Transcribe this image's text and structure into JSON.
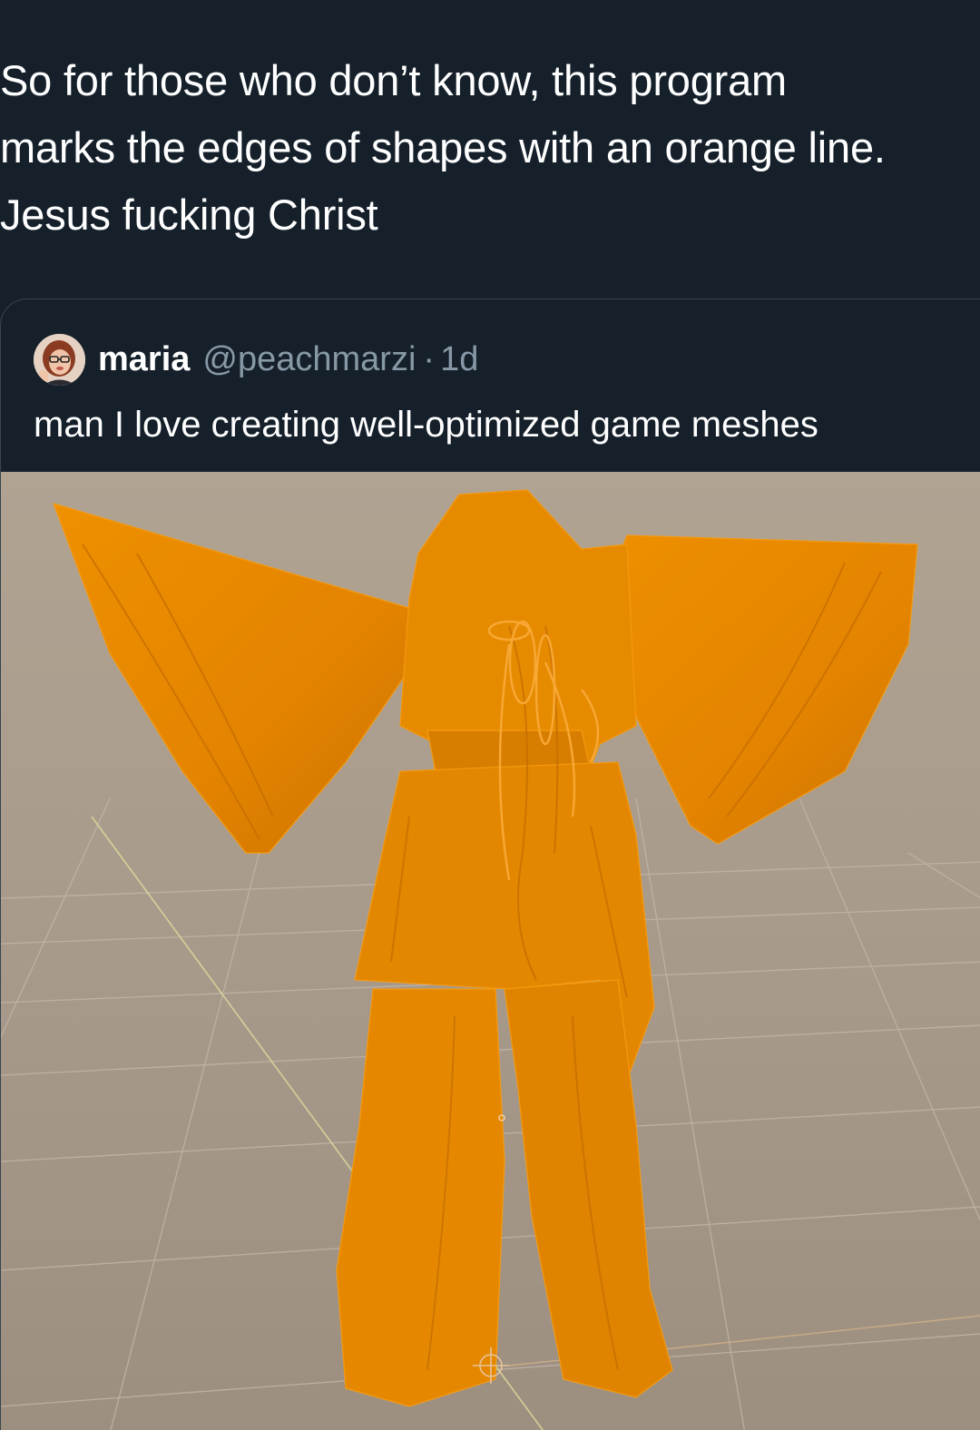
{
  "tweet": {
    "line1": "So for those who don’t know, this program",
    "line2": "marks the edges of shapes with an orange line.",
    "line3": "Jesus fucking Christ"
  },
  "quoted_tweet": {
    "display_name": "maria",
    "handle": "@peachmarzi",
    "separator": "·",
    "age": "1d",
    "text": "man I love creating well-optimized game meshes"
  },
  "media": {
    "icon": "orange-mesh-outfit-render",
    "colors": {
      "viewport_bg": "#a8998a",
      "mesh_orange": "#e58800",
      "mesh_dark": "#c86f00",
      "grid": "#bdb2a5",
      "axis": "#d8d79a"
    }
  },
  "colors": {
    "background": "#15202b",
    "text": "#ffffff",
    "muted": "#8899a6",
    "border": "#38444d"
  }
}
